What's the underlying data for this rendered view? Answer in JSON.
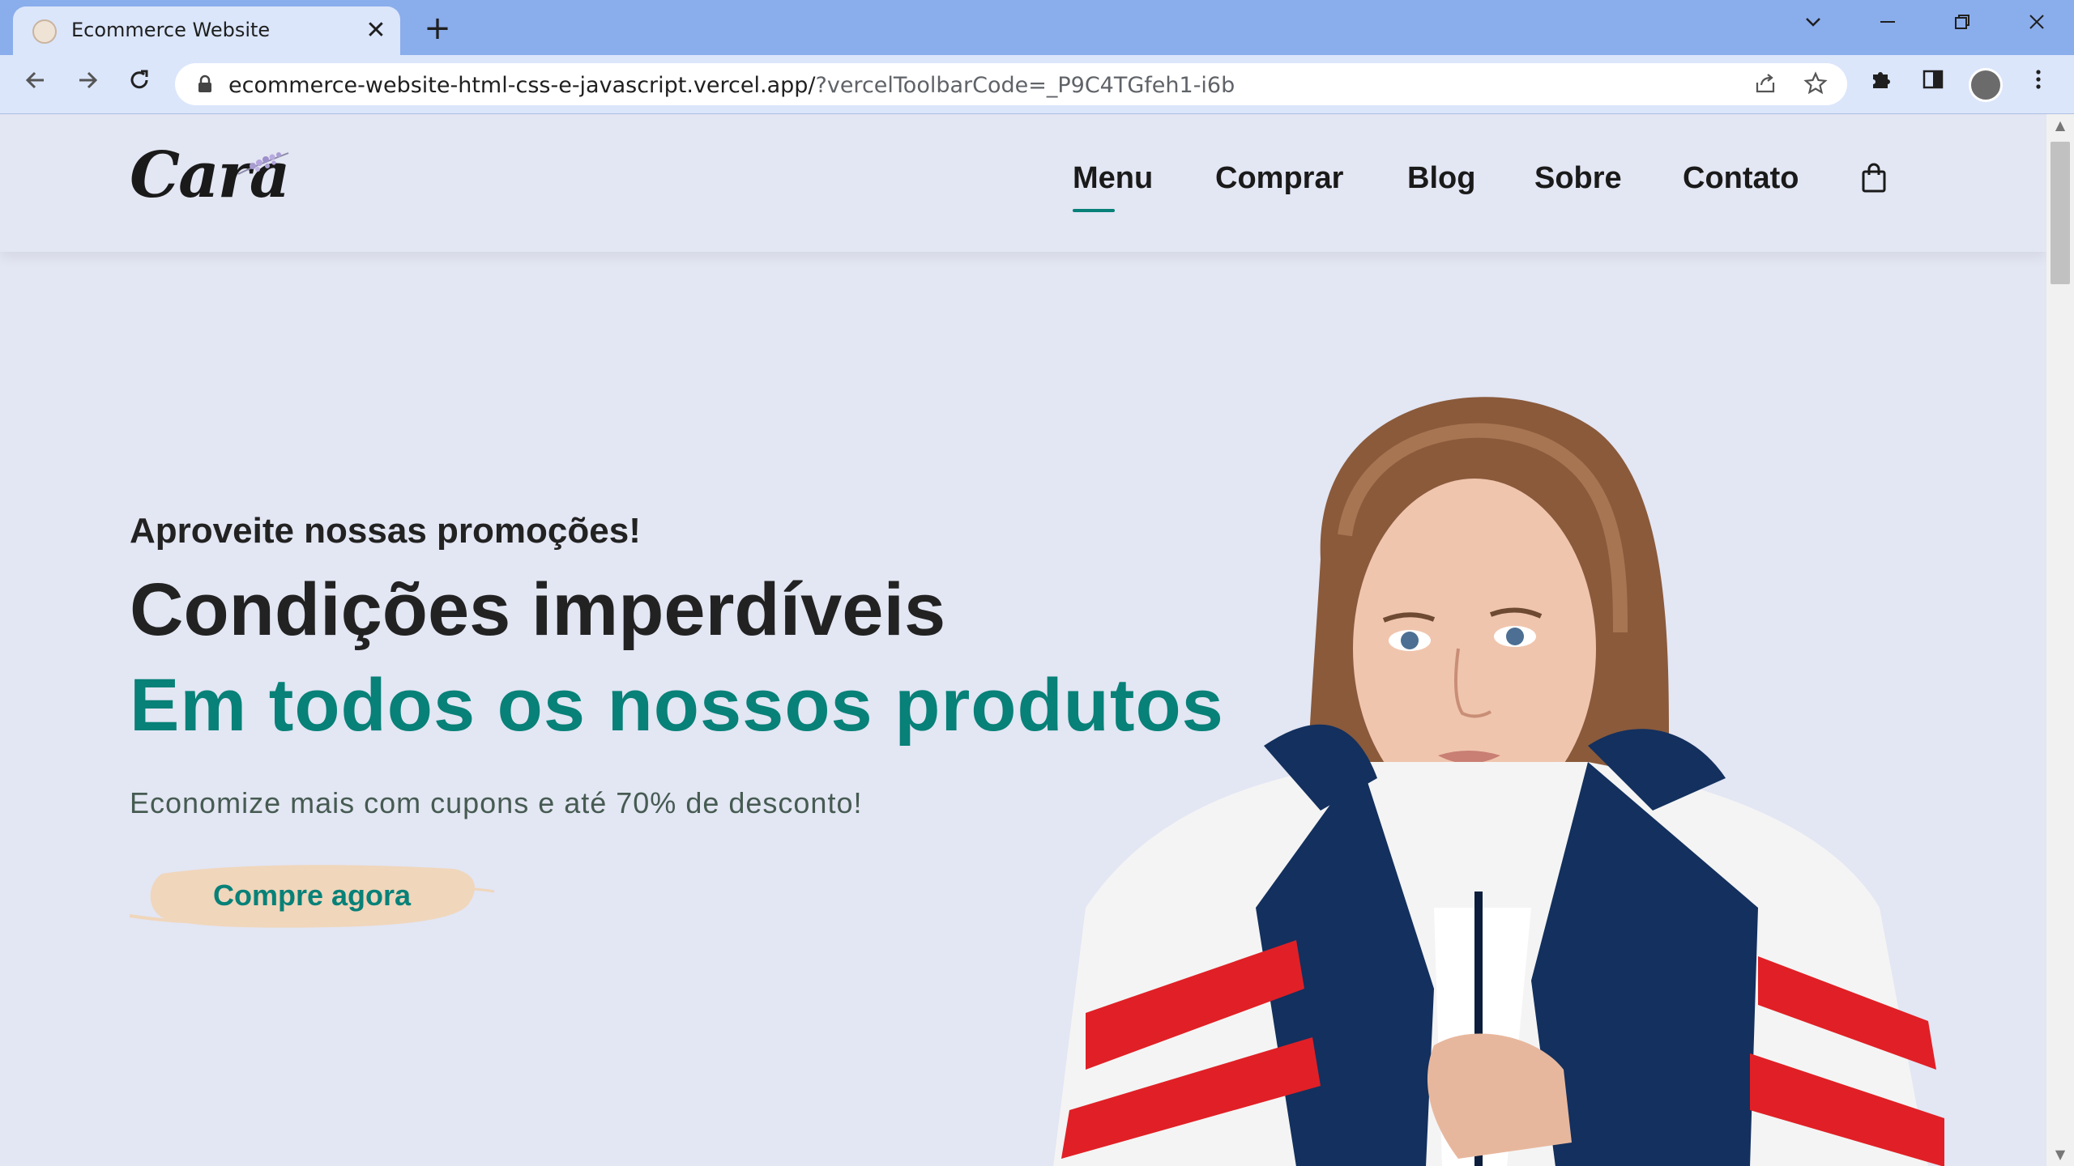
{
  "browser": {
    "tab_title": "Ecommerce Website",
    "tab_close_glyph": "✕",
    "new_tab_glyph": "+",
    "url_host": "ecommerce-website-html-css-e-javascript.vercel.app/",
    "url_rest": "?vercelToolbarCode=_P9C4TGfeh1-i6b",
    "icons": [
      "back-icon",
      "forward-icon",
      "reload-icon",
      "lock-icon",
      "share-icon",
      "star-icon",
      "extensions-icon",
      "side-panel-icon",
      "profile-avatar",
      "more-icon",
      "tab-search-icon",
      "minimize-icon",
      "restore-icon",
      "close-window-icon"
    ]
  },
  "site": {
    "logo": "Cara",
    "nav": [
      "Menu",
      "Comprar",
      "Blog",
      "Sobre",
      "Contato"
    ],
    "active_nav": "Menu",
    "accent_color": "#088178",
    "background_color": "#e3e6f3"
  },
  "hero": {
    "kicker": "Aproveite nossas promoções!",
    "title_line1": "Condições imperdíveis",
    "title_line2": "Em todos os nossos produtos",
    "subtitle": "Economize mais com cupons e até 70% de desconto!",
    "cta_label": "Compre agora"
  }
}
